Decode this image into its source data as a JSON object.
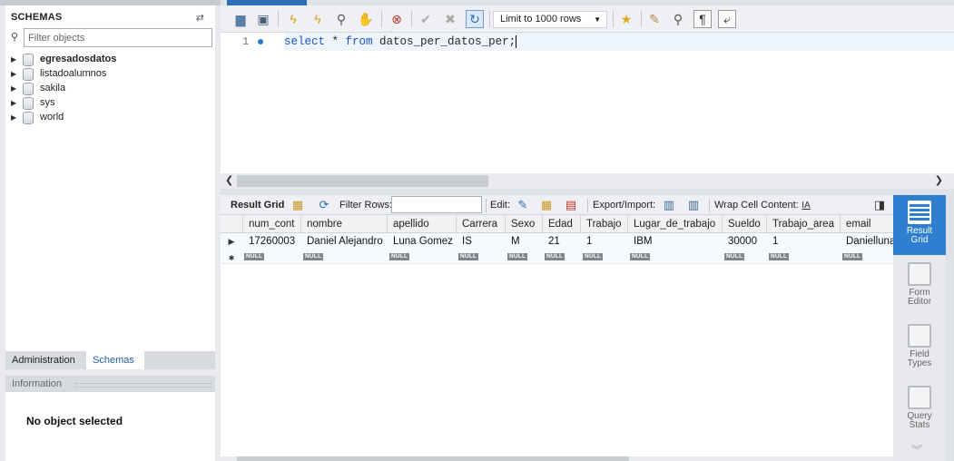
{
  "navigator": {
    "schemas_title": "SCHEMAS",
    "filter_placeholder": "Filter objects",
    "schemas": [
      {
        "name": "egresadosdatos",
        "bold": true
      },
      {
        "name": "listadoalumnos",
        "bold": false
      },
      {
        "name": "sakila",
        "bold": false
      },
      {
        "name": "sys",
        "bold": false
      },
      {
        "name": "world",
        "bold": false
      }
    ],
    "tab_admin": "Administration",
    "tab_schemas": "Schemas",
    "info_title": "Information",
    "no_object": "No object selected"
  },
  "toolbar": {
    "limit_label": "Limit to 1000 rows"
  },
  "editor": {
    "line_number": "1",
    "kw_select": "select",
    "star": " * ",
    "kw_from": "from",
    "table_text": " datos_per_datos_per;"
  },
  "result_toolbar": {
    "result_grid": "Result Grid",
    "filter_rows": "Filter Rows:",
    "edit": "Edit:",
    "export_import": "Export/Import:",
    "wrap_cell": "Wrap Cell Content:"
  },
  "grid": {
    "columns": [
      "num_cont",
      "nombre",
      "apellido",
      "Carrera",
      "Sexo",
      "Edad",
      "Trabajo",
      "Lugar_de_trabajo",
      "Sueldo",
      "Trabajo_area",
      "email"
    ],
    "row": [
      "17260003",
      "Daniel Alejandro",
      "Luna Gomez",
      "IS",
      "M",
      "21",
      "1",
      "IBM",
      "30000",
      "1",
      "Daniellunag"
    ],
    "null_label": "NULL"
  },
  "side_panel": {
    "result_grid": "Result Grid",
    "form_editor": "Form Editor",
    "field_types": "Field Types",
    "query_stats": "Query Stats"
  }
}
